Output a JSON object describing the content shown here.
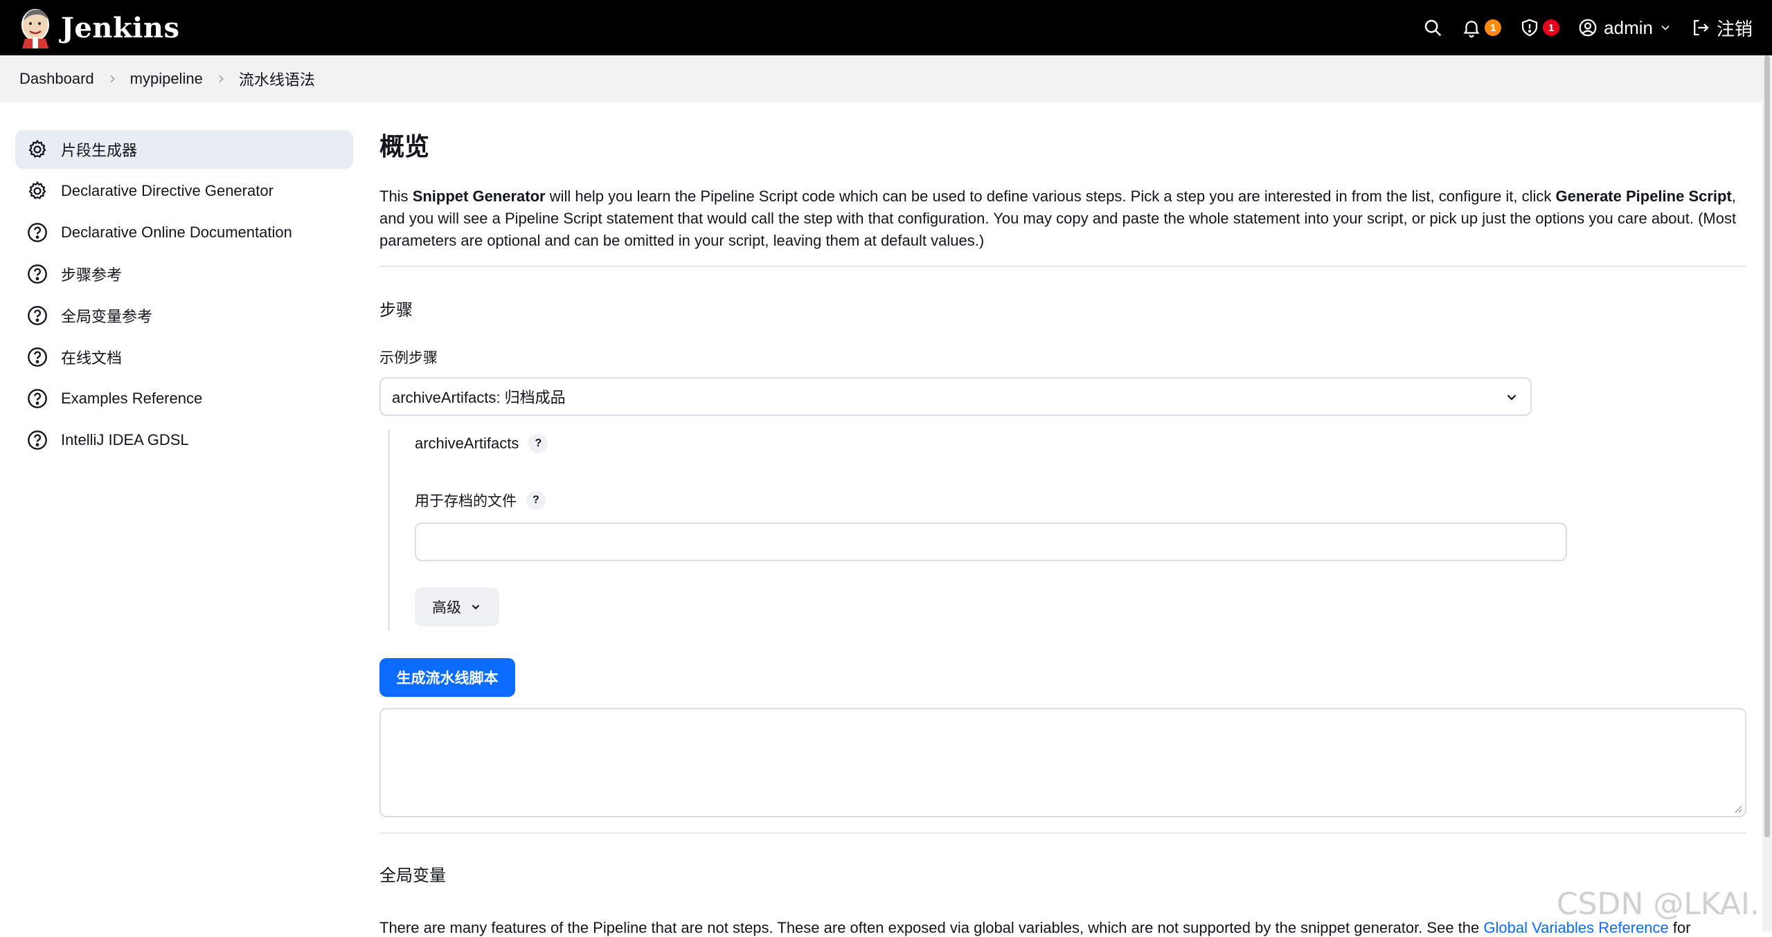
{
  "header": {
    "brand": "Jenkins",
    "notification_count": "1",
    "security_count": "1",
    "user": "admin",
    "logout": "注销"
  },
  "breadcrumb": [
    "Dashboard",
    "mypipeline",
    "流水线语法"
  ],
  "sidebar": {
    "items": [
      {
        "label": "片段生成器",
        "icon": "gear-icon",
        "active": true
      },
      {
        "label": "Declarative Directive Generator",
        "icon": "gear-icon"
      },
      {
        "label": "Declarative Online Documentation",
        "icon": "help-circle-icon"
      },
      {
        "label": "步骤参考",
        "icon": "help-circle-icon"
      },
      {
        "label": "全局变量参考",
        "icon": "help-circle-icon"
      },
      {
        "label": "在线文档",
        "icon": "help-circle-icon"
      },
      {
        "label": "Examples Reference",
        "icon": "help-circle-icon"
      },
      {
        "label": "IntelliJ IDEA GDSL",
        "icon": "help-circle-icon"
      }
    ]
  },
  "main": {
    "title": "概览",
    "intro": {
      "p1": "This ",
      "b1": "Snippet Generator",
      "p2": " will help you learn the Pipeline Script code which can be used to define various steps. Pick a step you are interested in from the list, configure it, click ",
      "b2": "Generate Pipeline Script",
      "p3": ", and you will see a Pipeline Script statement that would call the step with that configuration. You may copy and paste the whole statement into your script, or pick up just the options you care about. (Most parameters are optional and can be omitted in your script, leaving them at default values.)"
    },
    "steps_title": "步骤",
    "sample_step_label": "示例步骤",
    "sample_step_value": "archiveArtifacts: 归档成品",
    "step_name": "archiveArtifacts",
    "files_label": "用于存档的文件",
    "files_value": "",
    "advanced_label": "高级",
    "generate_label": "生成流水线脚本",
    "output_value": "",
    "globals_title": "全局变量",
    "globals_text": "There are many features of the Pipeline that are not steps. These are often exposed via global variables, which are not supported by the snippet generator. See the ",
    "globals_link": "Global Variables Reference",
    "globals_after": " for"
  },
  "watermark": "CSDN @LKAI."
}
